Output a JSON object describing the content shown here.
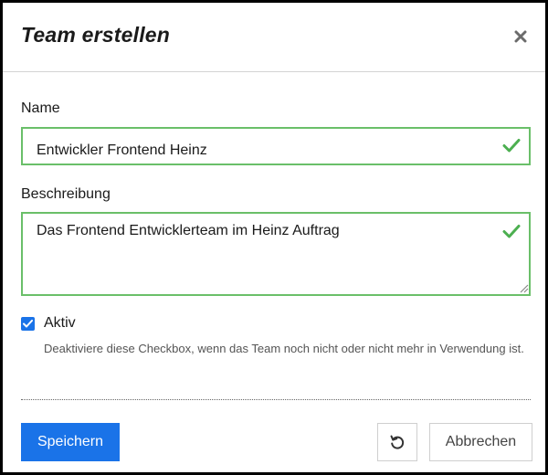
{
  "dialog": {
    "title": "Team erstellen",
    "close_icon": "close-icon"
  },
  "form": {
    "name": {
      "label": "Name",
      "value": "Entwickler Frontend Heinz",
      "valid": true
    },
    "description": {
      "label": "Beschreibung",
      "value": "Das Frontend Entwicklerteam im Heinz Auftrag",
      "valid": true
    },
    "active": {
      "label": "Aktiv",
      "checked": true,
      "help": "Deaktiviere diese Checkbox, wenn das Team noch nicht oder nicht mehr in Verwendung ist."
    }
  },
  "footer": {
    "save_label": "Speichern",
    "reset_icon": "reset-icon",
    "cancel_label": "Abbrechen"
  },
  "colors": {
    "primary": "#1a73e8",
    "valid_border": "#6abf69",
    "valid_check": "#4caf50"
  }
}
